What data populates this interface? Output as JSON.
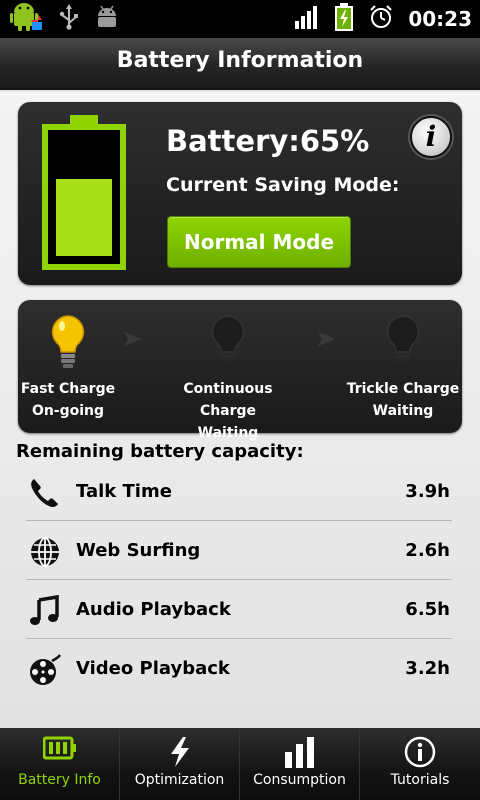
{
  "status_bar": {
    "time": "00:23"
  },
  "header": {
    "title": "Battery Information"
  },
  "battery": {
    "level_fraction": 0.65,
    "percent_text": "Battery:65%",
    "mode_label": "Current Saving Mode:",
    "mode_button": "Normal Mode",
    "info_icon": "info-icon",
    "accent_color": "#8fd400"
  },
  "charge_stages": [
    {
      "line1": "Fast Charge",
      "line2": "On-going",
      "active": true
    },
    {
      "line1": "Continuous Charge",
      "line2": "Waiting",
      "active": false
    },
    {
      "line1": "Trickle Charge",
      "line2": "Waiting",
      "active": false
    }
  ],
  "remaining": {
    "title": "Remaining battery capacity:",
    "items": [
      {
        "label": "Talk Time",
        "value": "3.9h",
        "icon": "phone-icon"
      },
      {
        "label": "Web Surfing",
        "value": "2.6h",
        "icon": "globe-icon"
      },
      {
        "label": "Audio Playback",
        "value": "6.5h",
        "icon": "music-note-icon"
      },
      {
        "label": "Video Playback",
        "value": "3.2h",
        "icon": "film-reel-icon"
      }
    ]
  },
  "nav": {
    "tabs": [
      {
        "label": "Battery Info",
        "icon": "battery-icon",
        "active": true
      },
      {
        "label": "Optimization",
        "icon": "lightning-icon",
        "active": false
      },
      {
        "label": "Consumption",
        "icon": "bar-chart-icon",
        "active": false
      },
      {
        "label": "Tutorials",
        "icon": "info-icon",
        "active": false
      }
    ]
  }
}
